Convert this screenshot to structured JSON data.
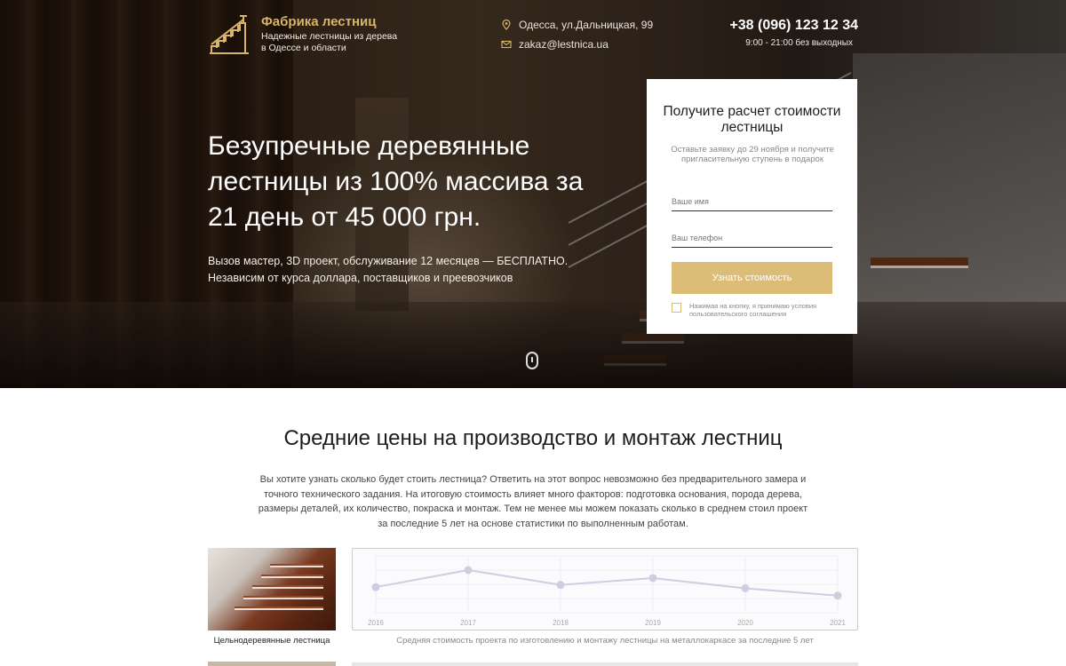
{
  "header": {
    "brand_title": "Фабрика лестниц",
    "brand_subtitle": "Надежные лестницы из дерева в Одессе и области",
    "address": "Одесса, ул.Дальницкая, 99",
    "email": "zakaz@lestnica.ua",
    "phone": "+38 (096) 123 12 34",
    "hours": "9:00 - 21:00 без выходных"
  },
  "hero": {
    "headline": "Безупречные деревянные лестницы из 100% массива за 21 день от 45 000 грн.",
    "subline": "Вызов мастер, 3D проект, обслуживание 12 месяцев — БЕСПЛАТНО. Независим от курса доллара, поставщиков и преевозчиков"
  },
  "form": {
    "title": "Получите расчет стоимости лестницы",
    "description": "Оставьте заявку до 29 ноября и получите пригласительную ступень в подарок",
    "name_placeholder": "Ваше имя",
    "phone_placeholder": "Ваш телефон",
    "submit_label": "Узнать стоимость",
    "agreement": "Нажимая на кнопку, я принимаю условия пользовательского соглашения"
  },
  "prices": {
    "title": "Средние цены на производство и монтаж лестниц",
    "text": "Вы хотите узнать сколько будет стоить лестница? Ответить на этот вопрос невозможно без предварительного замера и точного технического задания. На итоговую стоимость влияет много факторов: подготовка основания, порода дерева, размеры деталей, их количество, покраска и монтаж. Тем не менее мы можем показать сколько в среднем стоил проект за последние 5 лет на основе статистики по выполненным работам.",
    "photo_caption": "Цельнодеревянные лестница",
    "chart_caption": "Средняя стоимость проекта по изготовлению и монтажу лестницы на металлокаркасе за последние 5 лет"
  },
  "colors": {
    "accent": "#dbbd77",
    "brand": "#d8b56a",
    "chart_line": "#cfcde0"
  },
  "chart_data": {
    "type": "line",
    "categories": [
      "2016",
      "2017",
      "2018",
      "2019",
      "2020",
      "2021"
    ],
    "values": [
      0.45,
      0.75,
      0.49,
      0.61,
      0.43,
      0.3
    ],
    "ylim": [
      0,
      1
    ],
    "grid": true,
    "title": "",
    "xlabel": "",
    "ylabel": ""
  }
}
